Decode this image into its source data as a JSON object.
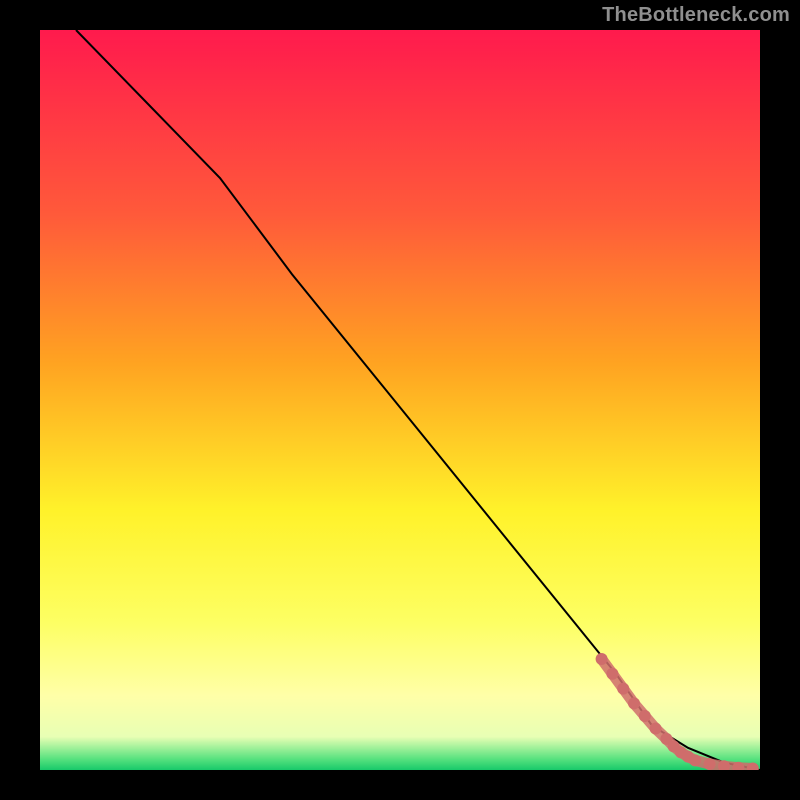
{
  "attribution": "TheBottleneck.com",
  "chart_data": {
    "type": "line",
    "title": "",
    "xlabel": "",
    "ylabel": "",
    "xlim": [
      0,
      100
    ],
    "ylim": [
      0,
      100
    ],
    "grid": false,
    "legend": false,
    "background_gradient_stops": [
      {
        "pos": 0.0,
        "color": "#ff1a4d"
      },
      {
        "pos": 0.25,
        "color": "#ff5a3a"
      },
      {
        "pos": 0.45,
        "color": "#ffa321"
      },
      {
        "pos": 0.65,
        "color": "#fff22a"
      },
      {
        "pos": 0.8,
        "color": "#fdff63"
      },
      {
        "pos": 0.9,
        "color": "#ffffa8"
      },
      {
        "pos": 0.955,
        "color": "#e8ffb4"
      },
      {
        "pos": 0.985,
        "color": "#58e27f"
      },
      {
        "pos": 1.0,
        "color": "#18c96a"
      }
    ],
    "series": [
      {
        "name": "curve",
        "style": "solid-black",
        "x": [
          5,
          15,
          25,
          35,
          45,
          55,
          65,
          75,
          80,
          85,
          90,
          95,
          100
        ],
        "y": [
          100,
          90,
          80,
          67,
          55,
          43,
          31,
          19,
          13,
          6,
          3,
          1,
          0
        ]
      },
      {
        "name": "highlighted-points",
        "style": "dots-rosy",
        "x": [
          78,
          79.5,
          81,
          82.5,
          84,
          85.5,
          87,
          88,
          89,
          90,
          91,
          93,
          95,
          97,
          99
        ],
        "y": [
          15,
          13,
          11,
          9,
          7.3,
          5.6,
          4.2,
          3.2,
          2.4,
          1.8,
          1.3,
          0.8,
          0.5,
          0.3,
          0.2
        ]
      }
    ],
    "colors": {
      "curve_stroke": "#000000",
      "highlight_fill": "#cf6d6b"
    }
  }
}
